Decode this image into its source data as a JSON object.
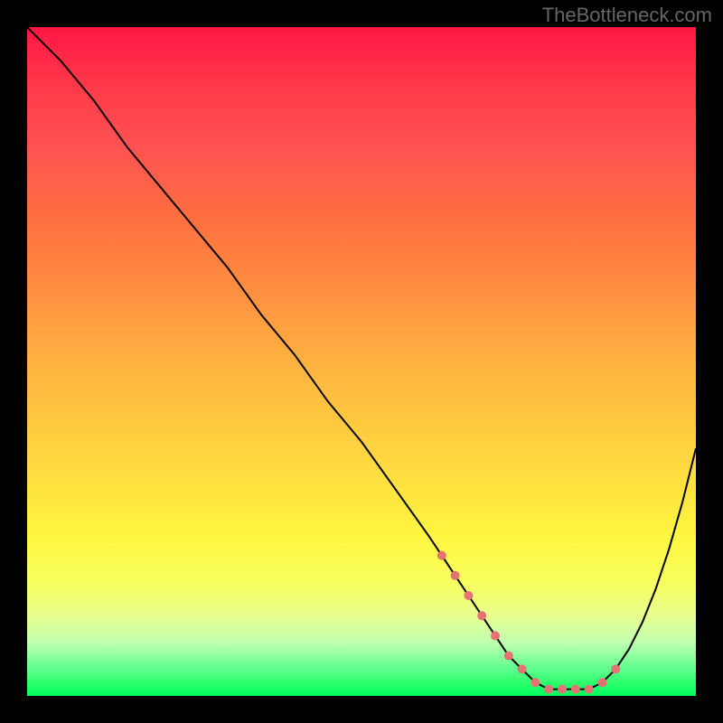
{
  "watermark": "TheBottleneck.com",
  "chart_data": {
    "type": "line",
    "title": "",
    "xlabel": "",
    "ylabel": "",
    "xlim": [
      0,
      100
    ],
    "ylim": [
      0,
      100
    ],
    "x": [
      0,
      5,
      10,
      15,
      20,
      25,
      30,
      35,
      40,
      45,
      50,
      55,
      60,
      62,
      64,
      66,
      68,
      70,
      72,
      74,
      76,
      78,
      80,
      82,
      84,
      86,
      88,
      90,
      92,
      94,
      96,
      98,
      100
    ],
    "values": [
      100,
      95,
      89,
      82,
      76,
      70,
      64,
      57,
      51,
      44,
      38,
      31,
      24,
      21,
      18,
      15,
      12,
      9,
      6,
      4,
      2,
      1,
      1,
      1,
      1,
      2,
      4,
      7,
      11,
      16,
      22,
      29,
      37
    ],
    "gradient_colors": {
      "top": "#ff1744",
      "mid_orange": "#ffab40",
      "mid_yellow": "#fff640",
      "bottom": "#00ff5e"
    },
    "marker_segment": {
      "x": [
        62,
        64,
        66,
        68,
        70,
        72,
        74,
        76,
        78,
        80,
        82,
        84,
        86,
        88
      ],
      "values": [
        21,
        18,
        15,
        12,
        9,
        6,
        4,
        2,
        1,
        1,
        1,
        1,
        2,
        4
      ],
      "color": "#e57373"
    }
  }
}
